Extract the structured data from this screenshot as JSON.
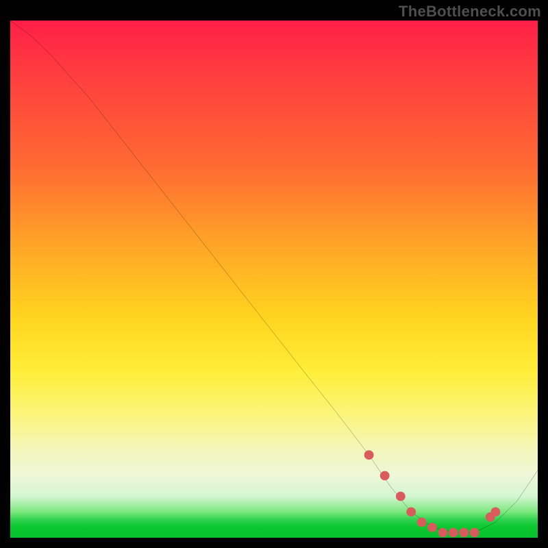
{
  "watermark": "TheBottleneck.com",
  "chart_data": {
    "type": "line",
    "title": "",
    "xlabel": "",
    "ylabel": "",
    "xlim": [
      0,
      100
    ],
    "ylim": [
      0,
      100
    ],
    "grid": false,
    "legend": false,
    "series": [
      {
        "name": "curve",
        "color": "#000000",
        "x": [
          0,
          4,
          8,
          15,
          25,
          35,
          45,
          55,
          62,
          68,
          72,
          76,
          80,
          84,
          88,
          92,
          96,
          100
        ],
        "y": [
          100,
          97,
          93,
          85,
          72,
          59,
          46,
          33,
          24,
          16,
          10,
          5,
          2,
          1,
          1,
          3,
          7,
          13
        ]
      }
    ],
    "marker_band": {
      "name": "optimal-range",
      "color": "#d95b5b",
      "x": [
        68,
        71,
        74,
        76,
        78,
        80,
        82,
        84,
        86,
        88,
        91,
        92
      ],
      "y": [
        16,
        12,
        8,
        5,
        3,
        2,
        1,
        1,
        1,
        1,
        4,
        5
      ]
    },
    "gradient_stops": [
      {
        "pos": 0.0,
        "color": "#ff1f47"
      },
      {
        "pos": 0.28,
        "color": "#ff6a32"
      },
      {
        "pos": 0.58,
        "color": "#ffd61f"
      },
      {
        "pos": 0.83,
        "color": "#f3f6bb"
      },
      {
        "pos": 0.96,
        "color": "#2fd24f"
      },
      {
        "pos": 1.0,
        "color": "#07c22d"
      }
    ]
  }
}
